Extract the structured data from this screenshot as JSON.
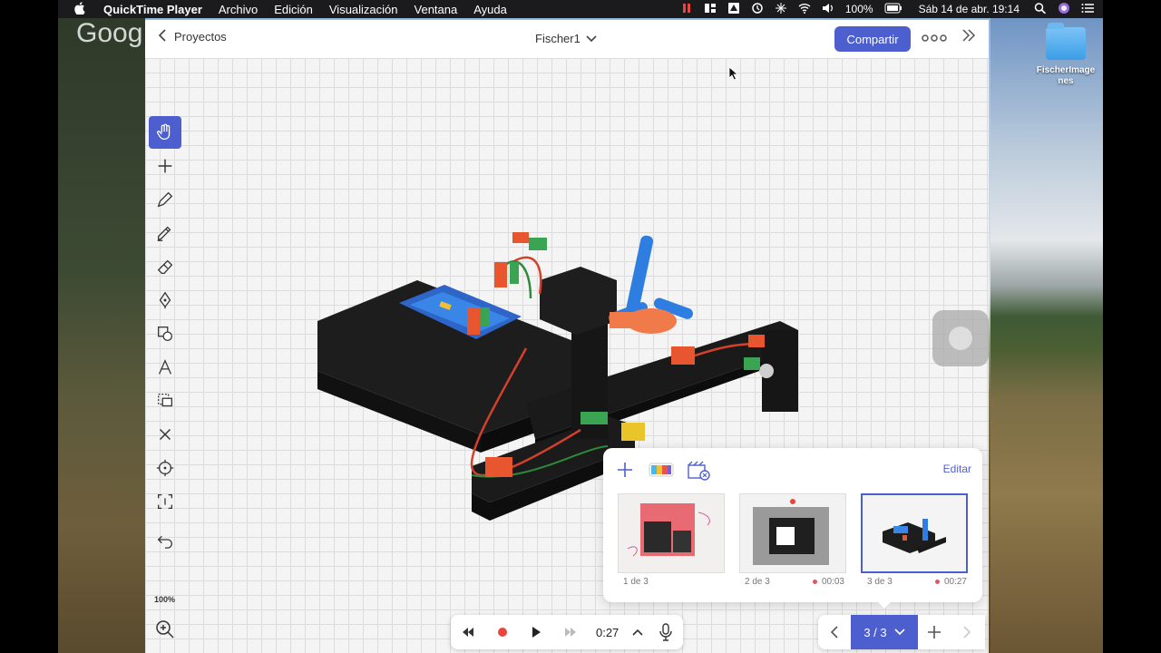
{
  "menubar": {
    "apple": "",
    "app_name": "QuickTime Player",
    "items": [
      "Archivo",
      "Edición",
      "Visualización",
      "Ventana",
      "Ayuda"
    ],
    "battery": "100%",
    "clock": "Sáb 14 de abr.  19:14"
  },
  "desktop": {
    "folder_label": "FischerImagenes",
    "watermark": "Goog"
  },
  "topbar": {
    "back_label": "Proyectos",
    "doc_title": "Fischer1",
    "share_label": "Compartir"
  },
  "tools": [
    "hand-icon",
    "plus-icon",
    "pencil-icon",
    "marker-icon",
    "eraser-icon",
    "pen-tool-icon",
    "shapes-icon",
    "text-icon",
    "select-copy-icon",
    "close-icon",
    "crosshair-icon",
    "selection-icon",
    "undo-icon"
  ],
  "zoom": {
    "level": "100%"
  },
  "slides": {
    "edit_label": "Editar",
    "items": [
      {
        "label": "1 de 3",
        "time": ""
      },
      {
        "label": "2 de 3",
        "time": "00:03"
      },
      {
        "label": "3 de 3",
        "time": "00:27"
      }
    ],
    "selected": 2
  },
  "playback": {
    "time": "0:27"
  },
  "pagenav": {
    "indicator": "3 / 3"
  },
  "colors": {
    "accent": "#4d5fcf",
    "record": "#e8453c"
  }
}
